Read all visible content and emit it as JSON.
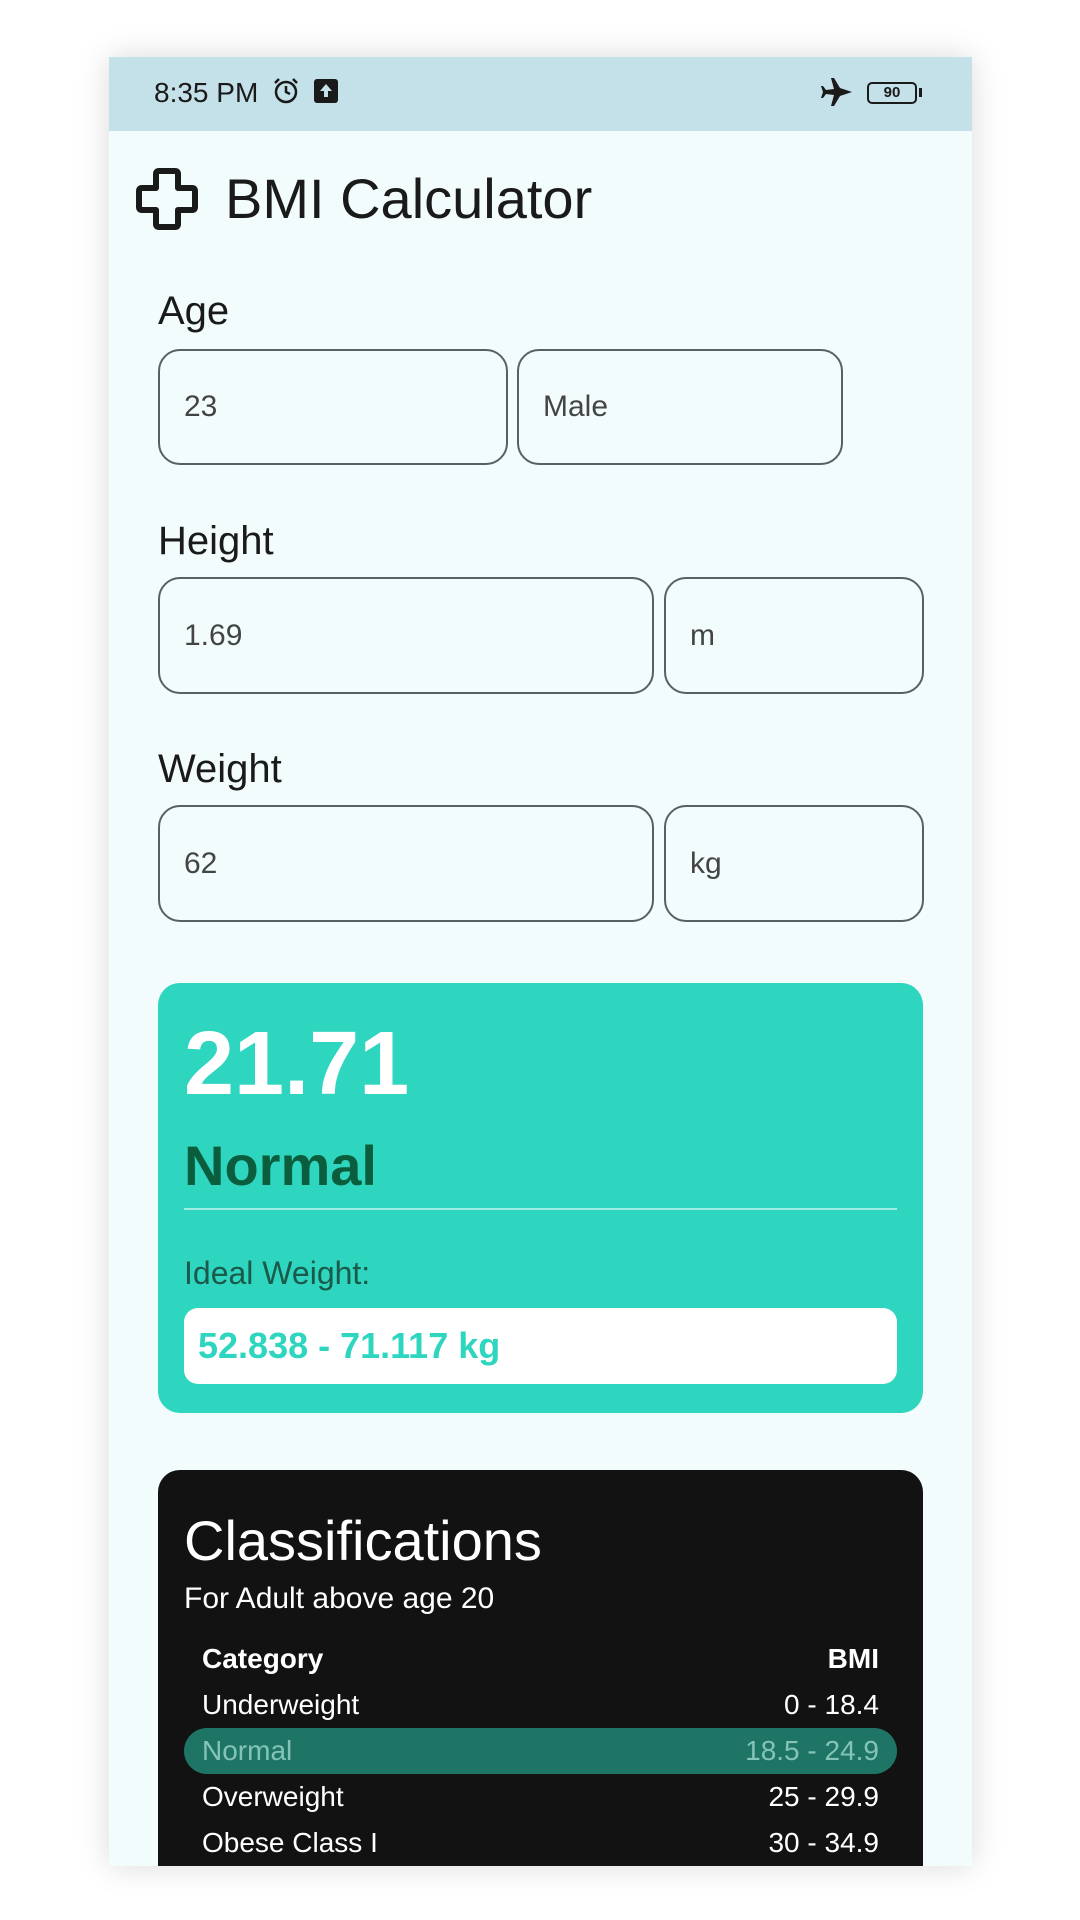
{
  "status_bar": {
    "time": "8:35 PM",
    "battery": "90",
    "icons": [
      "alarm-icon",
      "upload-icon",
      "airplane-icon",
      "battery-icon"
    ]
  },
  "header": {
    "icon": "plus-icon",
    "title": "BMI Calculator"
  },
  "age": {
    "label": "Age",
    "value": "23",
    "gender": "Male"
  },
  "height": {
    "label": "Height",
    "value": "1.69",
    "unit": "m"
  },
  "weight": {
    "label": "Weight",
    "value": "62",
    "unit": "kg"
  },
  "result": {
    "bmi": "21.71",
    "category": "Normal",
    "ideal_label": "Ideal Weight:",
    "ideal_range": "52.838 - 71.117 kg",
    "colors": {
      "card": "#2ed5bf",
      "category_text": "#0b5e3d"
    }
  },
  "classifications": {
    "title": "Classifications",
    "subtitle": "For Adult above age 20",
    "header": {
      "category": "Category",
      "bmi": "BMI"
    },
    "rows": [
      {
        "category": "Underweight",
        "bmi": "0 - 18.4",
        "highlighted": false
      },
      {
        "category": "Normal",
        "bmi": "18.5 - 24.9",
        "highlighted": true
      },
      {
        "category": "Overweight",
        "bmi": "25 - 29.9",
        "highlighted": false
      },
      {
        "category": "Obese Class I",
        "bmi": "30 - 34.9",
        "highlighted": false
      }
    ],
    "colors": {
      "card": "#121212",
      "highlight": "#1f7565"
    }
  }
}
